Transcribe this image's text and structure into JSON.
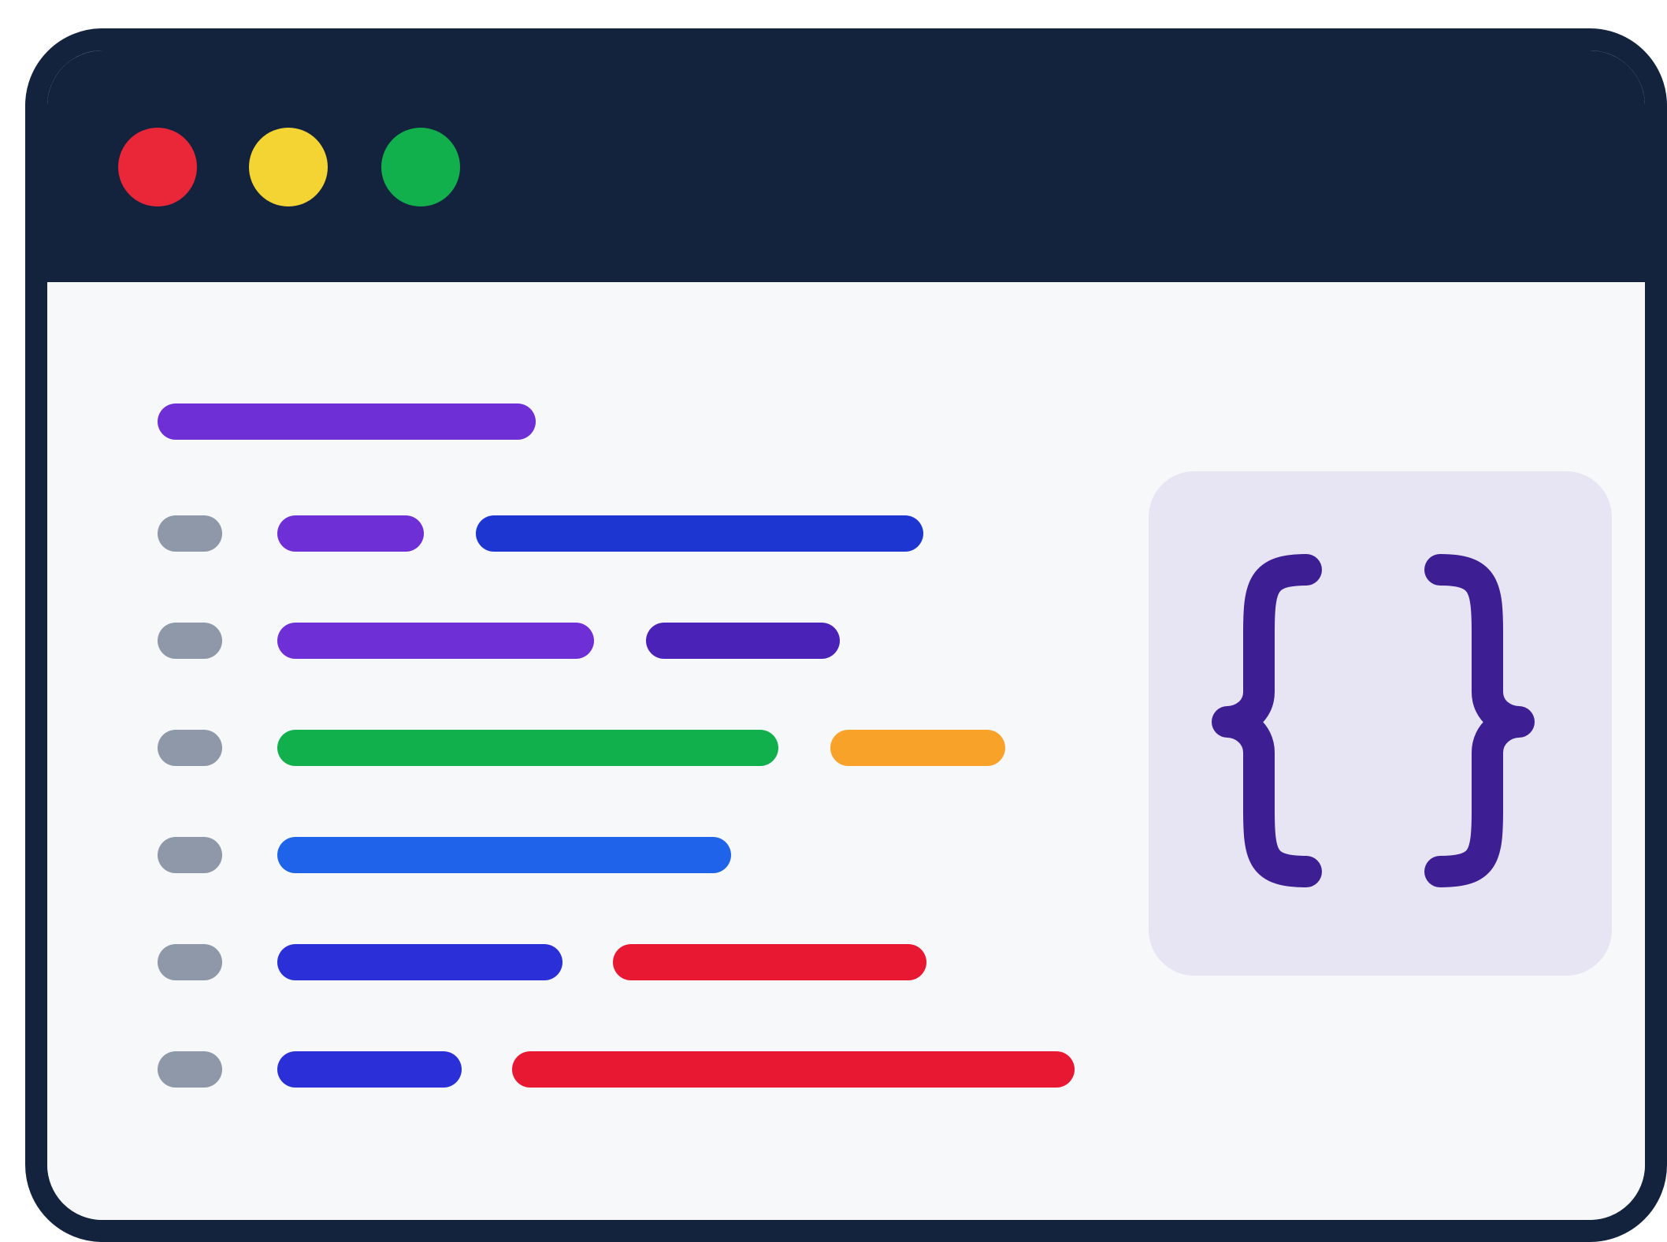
{
  "window": {
    "frame_color": "#14233d",
    "background": "#f7f8fa",
    "traffic_lights": [
      {
        "name": "close",
        "color": "#ea2639"
      },
      {
        "name": "minimize",
        "color": "#f4d432"
      },
      {
        "name": "maximize",
        "color": "#12b04c"
      }
    ]
  },
  "code": {
    "heading_bar_color": "#6f2fd6",
    "gutter_color": "#8e98a8",
    "lines": [
      {
        "tokens": [
          {
            "color": "#6f2fd6"
          },
          {
            "color": "#1d36d2"
          }
        ]
      },
      {
        "tokens": [
          {
            "color": "#6f2fd6"
          },
          {
            "color": "#4a22b8"
          }
        ]
      },
      {
        "tokens": [
          {
            "color": "#12b04c"
          },
          {
            "color": "#f8a22a"
          }
        ]
      },
      {
        "tokens": [
          {
            "color": "#1f63ea"
          }
        ]
      },
      {
        "tokens": [
          {
            "color": "#2b2fd8"
          },
          {
            "color": "#e81832"
          }
        ]
      },
      {
        "tokens": [
          {
            "color": "#2b2fd8"
          },
          {
            "color": "#e81832"
          }
        ]
      }
    ]
  },
  "brace_card": {
    "icon": "curly-braces-icon",
    "background": "#e7e5f3",
    "glyph_color": "#3d1f93"
  }
}
